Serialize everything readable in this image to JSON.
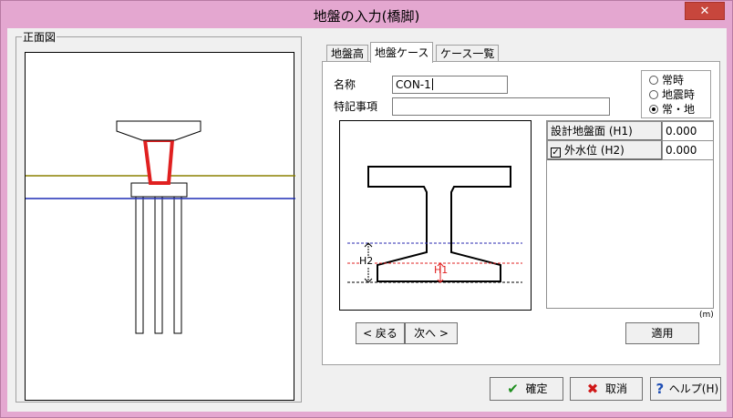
{
  "window": {
    "title": "地盤の入力(橋脚)",
    "close_glyph": "✕"
  },
  "front_view": {
    "legend": "正面図"
  },
  "tabs": [
    {
      "label": "地盤高",
      "active": false
    },
    {
      "label": "地盤ケース",
      "active": true
    },
    {
      "label": "ケース一覧",
      "active": false
    }
  ],
  "form": {
    "name_label": "名称",
    "name_value": "CON-1",
    "notes_label": "特記事項",
    "notes_value": ""
  },
  "condition": {
    "options": [
      {
        "label": "常時",
        "selected": false
      },
      {
        "label": "地震時",
        "selected": false
      },
      {
        "label": "常・地",
        "selected": true
      }
    ]
  },
  "diagram": {
    "label_h2": "H2",
    "label_h1": "H1"
  },
  "grid": {
    "rows": [
      {
        "label": "設計地盤面 (H1)",
        "checkbox": false,
        "value": "0.000"
      },
      {
        "label": "外水位 (H2)",
        "checkbox": true,
        "value": "0.000"
      }
    ],
    "unit": "(m)"
  },
  "nav": {
    "back_label": "< 戻る",
    "next_label": "次へ >",
    "apply_label": "適用"
  },
  "footer": {
    "ok_label": "確定",
    "cancel_label": "取消",
    "help_label": "ヘルプ(H)"
  },
  "colors": {
    "ground_line": "#8b8000",
    "water_line": "#1f2db5",
    "column": "#e02020",
    "dashed_blue": "#2a2ab0",
    "dashed_red": "#e02020",
    "ok_icon": "#1f8f1f",
    "cancel_icon": "#d01818",
    "help_icon": "#1f4fb5"
  }
}
